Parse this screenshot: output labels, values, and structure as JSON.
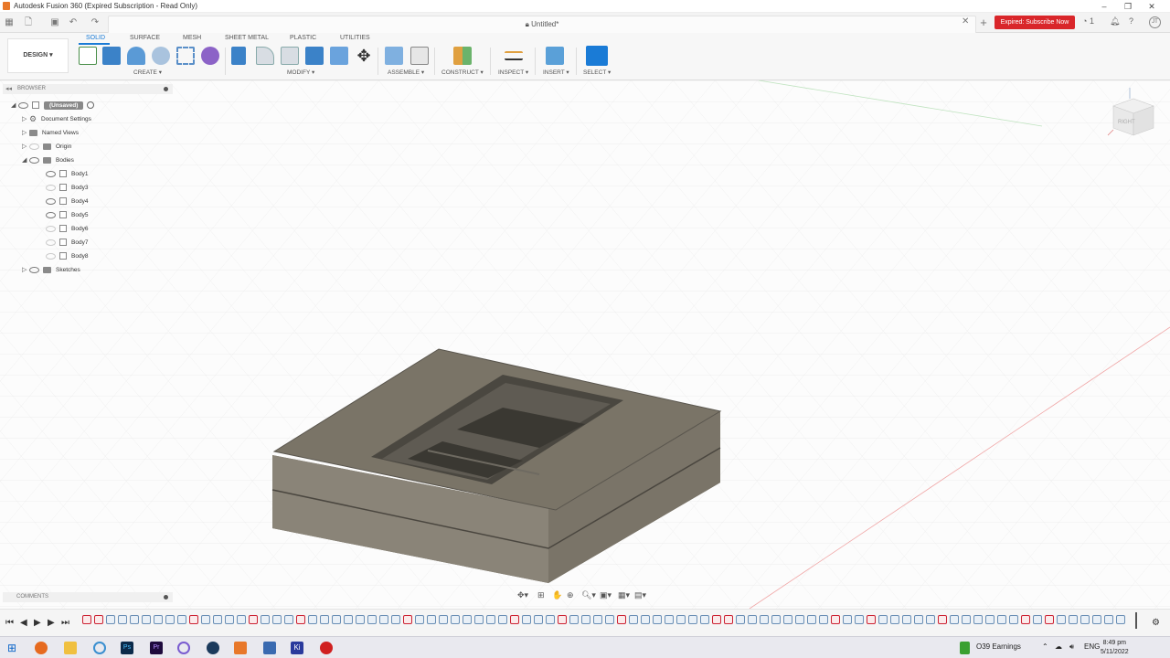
{
  "window": {
    "title": "Autodesk Fusion 360 (Expired Subscription - Read Only)",
    "doc_title": "Untitled*",
    "subscribe_button": "Expired: Subscribe Now",
    "notification_count": "1",
    "user_initials": "JT"
  },
  "toolbar": {
    "workspace": "DESIGN",
    "tabs": [
      "SOLID",
      "SURFACE",
      "MESH",
      "SHEET METAL",
      "PLASTIC",
      "UTILITIES"
    ],
    "groups": [
      "CREATE",
      "MODIFY",
      "ASSEMBLE",
      "CONSTRUCT",
      "INSPECT",
      "INSERT",
      "SELECT"
    ]
  },
  "browser": {
    "header": "BROWSER",
    "root": "(Unsaved)",
    "document_settings": "Document Settings",
    "named_views": "Named Views",
    "origin": "Origin",
    "bodies": "Bodies",
    "body_items": [
      "Body1",
      "Body3",
      "Body4",
      "Body5",
      "Body6",
      "Body7",
      "Body8"
    ],
    "sketches": "Sketches"
  },
  "comments": {
    "label": "COMMENTS"
  },
  "viewcube": {
    "face_label": "RIGHT"
  },
  "taskbar": {
    "widget_text": "O39 Earnings",
    "lang": "ENG",
    "time": "8:49 pm",
    "date": "5/11/2022"
  },
  "colors": {
    "accent": "#1a7bd6",
    "expired_red": "#d9262a",
    "model_body": "#7a7467"
  }
}
